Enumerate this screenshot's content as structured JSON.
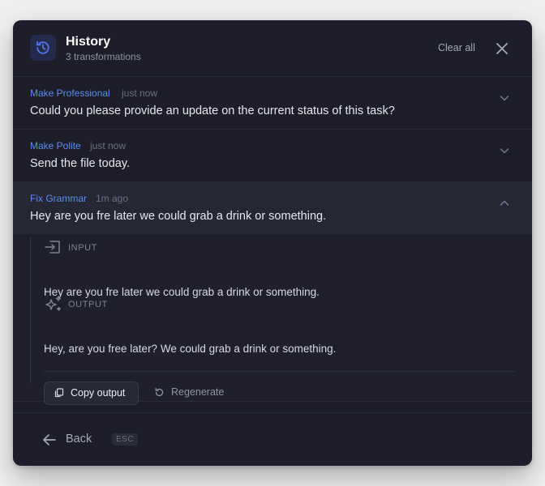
{
  "header": {
    "title": "History",
    "subtitle": "3 transformations",
    "clear_label": "Clear all",
    "icon": "history-icon",
    "close_icon": "close-icon"
  },
  "items": [
    {
      "type": "Make Professional",
      "time": "just now",
      "text": "Could you please provide an update on the current status of this task?",
      "expanded": false
    },
    {
      "type": "Make Polite",
      "time": "just now",
      "text": "Send the file today.",
      "expanded": false
    },
    {
      "type": "Fix Grammar",
      "time": "1m ago",
      "text": "Hey are you fre later we could grab a drink or something.",
      "expanded": true
    }
  ],
  "detail": {
    "input_label": "INPUT",
    "input_text": "Hey are you fre later we could grab a drink or something.",
    "output_label": "OUTPUT",
    "output_text": "Hey, are you free later? We could grab a drink or something.",
    "copy_label": "Copy output",
    "regenerate_label": "Regenerate"
  },
  "footer": {
    "back_label": "Back",
    "shortcut": "ESC"
  },
  "colors": {
    "panel_bg": "#1d1e2a",
    "accent": "#5b8cf0",
    "expanded_bg": "#262735"
  }
}
